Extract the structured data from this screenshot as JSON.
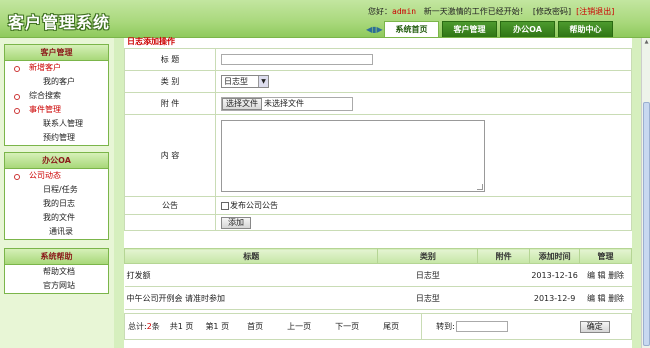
{
  "app": {
    "title": "客户管理系统"
  },
  "header": {
    "greeting": "您好：",
    "username": "admin",
    "message": "新一天激情的工作已经开始！",
    "change_password": "[修改密码]",
    "logout": "[注销退出]",
    "tabs": [
      "系统首页",
      "客户管理",
      "办公OA",
      "帮助中心"
    ],
    "active_tab": 0
  },
  "sidebar": {
    "sections": [
      {
        "title": "客户管理",
        "items": [
          {
            "label": "新增客户",
            "kind": "group"
          },
          {
            "label": "我的客户",
            "kind": "sub"
          },
          {
            "label": "综合搜索",
            "kind": "sub"
          },
          {
            "label": "事件管理",
            "kind": "group"
          },
          {
            "label": "联系人管理",
            "kind": "sub"
          },
          {
            "label": "预约管理",
            "kind": "sub"
          }
        ]
      },
      {
        "title": "办公OA",
        "items": [
          {
            "label": "公司动态",
            "kind": "group"
          },
          {
            "label": "日程/任务",
            "kind": "sub"
          },
          {
            "label": "我的日志",
            "kind": "sub"
          },
          {
            "label": "我的文件",
            "kind": "sub"
          },
          {
            "label": "通讯录",
            "kind": "sub"
          }
        ]
      },
      {
        "title": "系统帮助",
        "items": [
          {
            "label": "帮助文档",
            "kind": "sub"
          },
          {
            "label": "官方网站",
            "kind": "sub"
          }
        ]
      }
    ]
  },
  "form": {
    "section_title": "日志添加操作",
    "title_label": "标 题",
    "title_value": "",
    "category_label": "类 别",
    "category_value": "日志型",
    "attachment_label": "附 件",
    "file_button": "选择文件",
    "file_status": "未选择文件",
    "content_label": "内 容",
    "content_value": "",
    "notice_label": "公告",
    "notice_checkbox": "发布公司公告",
    "submit": "添加"
  },
  "table": {
    "columns": [
      "标题",
      "类别",
      "附件",
      "添加时间",
      "管理"
    ],
    "rows": [
      {
        "title": "打发额",
        "category": "日志型",
        "attachment": "",
        "date": "2013-12-16",
        "edit": "编 辑",
        "delete": "删除"
      },
      {
        "title": "中午公司开例会 请准时参加",
        "category": "日志型",
        "attachment": "",
        "date": "2013-12-9",
        "edit": "编 辑",
        "delete": "删除"
      }
    ]
  },
  "pager": {
    "total_prefix": "总计:",
    "total_count": "2",
    "total_suffix": "条",
    "pages": "共1 页",
    "current": "第1 页",
    "first": "首页",
    "prev": "上一页",
    "next": "下一页",
    "last": "尾页",
    "goto_label": "转到:",
    "goto_value": "",
    "confirm": "确定"
  },
  "colors": {
    "header_green": "#a9d87c",
    "tab_green": "#2f7515",
    "accent_red": "#cc0000",
    "sidebar_bg": "#e8f6d6"
  }
}
